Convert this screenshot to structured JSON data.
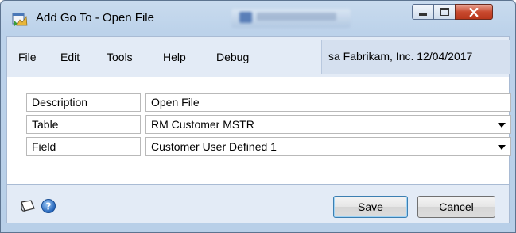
{
  "window": {
    "title": "Add Go To - Open File"
  },
  "menu": {
    "items": [
      "File",
      "Edit",
      "Tools",
      "Help",
      "Debug"
    ]
  },
  "userinfo": {
    "text": "sa  Fabrikam, Inc. 12/04/2017"
  },
  "form": {
    "description": {
      "label": "Description",
      "value": "Open File"
    },
    "table": {
      "label": "Table",
      "value": "RM Customer MSTR"
    },
    "field": {
      "label": "Field",
      "value": "Customer User Defined 1"
    }
  },
  "footer": {
    "save_label": "Save",
    "cancel_label": "Cancel"
  },
  "icons": {
    "app": "goto-window-icon",
    "note": "note-icon",
    "help": "help-icon"
  },
  "colors": {
    "close_button": "#c94a2f",
    "panel_bg": "#e3ebf6",
    "default_button_border": "#3c7fb1"
  }
}
